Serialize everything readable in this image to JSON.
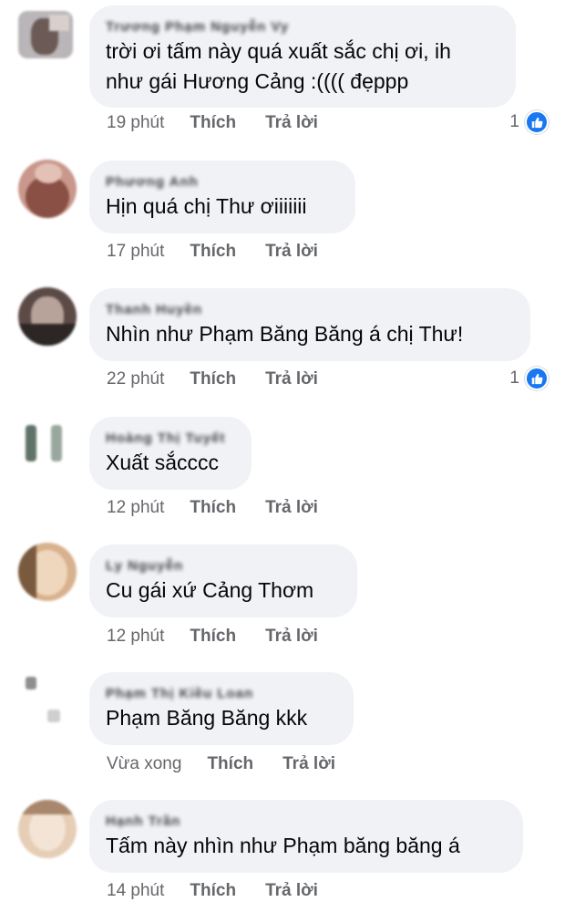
{
  "comments": [
    {
      "author": "Trương Phạm Nguyễn Vy",
      "text_lines": [
        "trời ơi tấm này quá xuất sắc chị ơi, ih",
        "như gái Hương Cảng :(((( đẹppp"
      ],
      "time": "19 phút",
      "like_label": "Thích",
      "reply_label": "Trả lời",
      "reactions": "1",
      "avatar_colors": [
        "#b9b5b8",
        "#6b5a55",
        "#d9d0cc"
      ]
    },
    {
      "author": "Phương Anh",
      "text_lines": [
        "Hịn quá chị Thư ơiiiiiii"
      ],
      "time": "17 phút",
      "like_label": "Thích",
      "reply_label": "Trả lời",
      "avatar_colors": [
        "#c9978b",
        "#8a4f45",
        "#e3c1b6"
      ]
    },
    {
      "author": "Thanh Huyền",
      "text_lines": [
        "Nhìn như Phạm Băng Băng á chị Thư!"
      ],
      "time": "22 phút",
      "like_label": "Thích",
      "reply_label": "Trả lời",
      "reactions": "1",
      "avatar_colors": [
        "#5c4a46",
        "#2c2625",
        "#b8a39b"
      ]
    },
    {
      "author": "Hoàng Thị Tuyết",
      "text_lines": [
        "Xuất sắcccc"
      ],
      "time": "12 phút",
      "like_label": "Thích",
      "reply_label": "Trả lời",
      "avatar_colors": [
        "#ffffff",
        "#5f7368",
        "#9aa79f"
      ]
    },
    {
      "author": "Ly Nguyễn",
      "text_lines": [
        "Cu gái xứ Cảng Thơm"
      ],
      "time": "12 phút",
      "like_label": "Thích",
      "reply_label": "Trả lời",
      "avatar_colors": [
        "#d8b28e",
        "#7a5a3e",
        "#efd7bd"
      ]
    },
    {
      "author": "Phạm Thị Kiều Loan",
      "text_lines": [
        "Phạm Băng Băng kkk"
      ],
      "time": "Vừa xong",
      "like_label": "Thích",
      "reply_label": "Trả lời",
      "avatar_colors": [
        "#ffffff",
        "#8e8e8e",
        "#cfcfcf"
      ]
    },
    {
      "author": "Hạnh Trần",
      "text_lines": [
        "Tấm này nhìn như Phạm băng băng á"
      ],
      "time": "14 phút",
      "like_label": "Thích",
      "reply_label": "Trả lời",
      "avatar_colors": [
        "#e6cdb5",
        "#a8876c",
        "#f3e4d6"
      ]
    }
  ],
  "colors": {
    "bubble": "#f0f2f5",
    "meta_text": "#65676b",
    "like_badge": "#1877f2"
  }
}
